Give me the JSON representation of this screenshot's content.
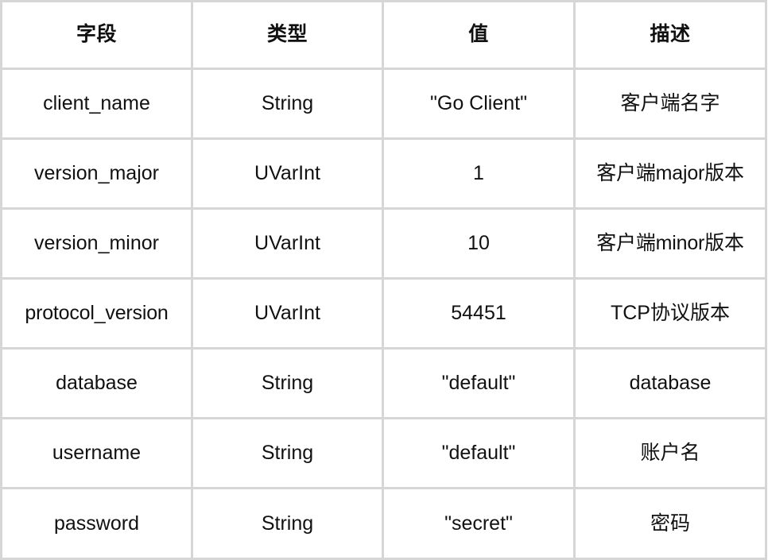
{
  "table": {
    "columns": [
      {
        "key": "field",
        "label": "字段"
      },
      {
        "key": "type",
        "label": "类型"
      },
      {
        "key": "value",
        "label": "值"
      },
      {
        "key": "description",
        "label": "描述"
      }
    ],
    "rows": [
      {
        "field": "client_name",
        "type": "String",
        "value": "\"Go Client\"",
        "description": "客户端名字"
      },
      {
        "field": "version_major",
        "type": "UVarInt",
        "value": "1",
        "description": "客户端major版本"
      },
      {
        "field": "version_minor",
        "type": "UVarInt",
        "value": "10",
        "description": "客户端minor版本"
      },
      {
        "field": "protocol_version",
        "type": "UVarInt",
        "value": "54451",
        "description": "TCP协议版本"
      },
      {
        "field": "database",
        "type": "String",
        "value": "\"default\"",
        "description": "database"
      },
      {
        "field": "username",
        "type": "String",
        "value": "\"default\"",
        "description": "账户名"
      },
      {
        "field": "password",
        "type": "String",
        "value": "\"secret\"",
        "description": "密码"
      }
    ]
  },
  "style": {
    "border_color": "#d6d6d6",
    "text_color": "#111111",
    "background": "#ffffff"
  }
}
